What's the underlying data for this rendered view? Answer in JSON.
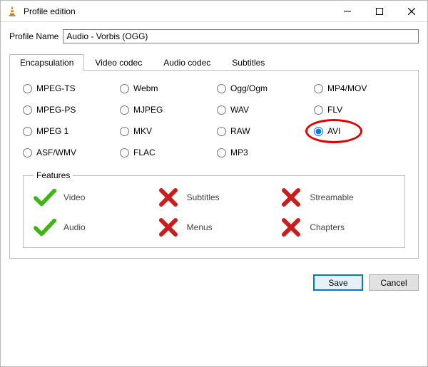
{
  "window": {
    "title": "Profile edition"
  },
  "profile": {
    "label": "Profile Name",
    "value": "Audio - Vorbis (OGG)"
  },
  "tabs": [
    {
      "label": "Encapsulation",
      "active": true
    },
    {
      "label": "Video codec",
      "active": false
    },
    {
      "label": "Audio codec",
      "active": false
    },
    {
      "label": "Subtitles",
      "active": false
    }
  ],
  "encapsulation": {
    "options": [
      {
        "label": "MPEG-TS",
        "checked": false
      },
      {
        "label": "Webm",
        "checked": false
      },
      {
        "label": "Ogg/Ogm",
        "checked": false
      },
      {
        "label": "MP4/MOV",
        "checked": false
      },
      {
        "label": "MPEG-PS",
        "checked": false
      },
      {
        "label": "MJPEG",
        "checked": false
      },
      {
        "label": "WAV",
        "checked": false
      },
      {
        "label": "FLV",
        "checked": false
      },
      {
        "label": "MPEG 1",
        "checked": false
      },
      {
        "label": "MKV",
        "checked": false
      },
      {
        "label": "RAW",
        "checked": false
      },
      {
        "label": "AVI",
        "checked": true,
        "highlight": true
      },
      {
        "label": "ASF/WMV",
        "checked": false
      },
      {
        "label": "FLAC",
        "checked": false
      },
      {
        "label": "MP3",
        "checked": false
      }
    ]
  },
  "features": {
    "legend": "Features",
    "items": [
      {
        "label": "Video",
        "ok": true
      },
      {
        "label": "Subtitles",
        "ok": false
      },
      {
        "label": "Streamable",
        "ok": false
      },
      {
        "label": "Audio",
        "ok": true
      },
      {
        "label": "Menus",
        "ok": false
      },
      {
        "label": "Chapters",
        "ok": false
      }
    ]
  },
  "buttons": {
    "save": "Save",
    "cancel": "Cancel"
  },
  "colors": {
    "accent": "#0078d7",
    "highlight_ring": "#e30000",
    "ok_icon": "#3fb611",
    "fail_icon": "#c81e1e"
  }
}
